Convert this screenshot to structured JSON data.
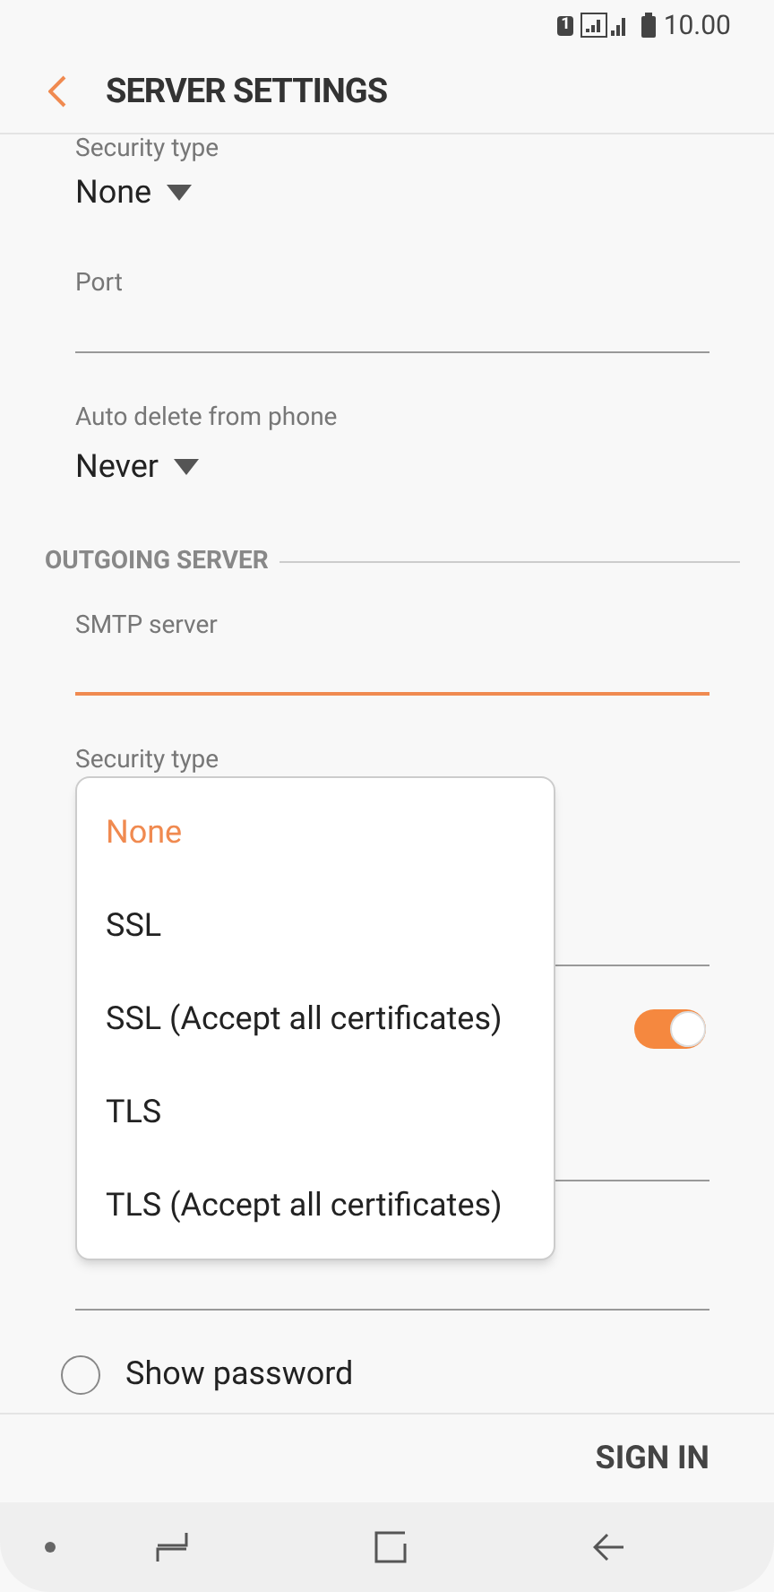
{
  "status_bar": {
    "sim": "1",
    "time": "10.00"
  },
  "header": {
    "title": "SERVER SETTINGS"
  },
  "incoming": {
    "security_label": "Security type",
    "security_value": "None",
    "port_label": "Port",
    "auto_delete_label": "Auto delete from phone",
    "auto_delete_value": "Never"
  },
  "outgoing": {
    "section_title": "OUTGOING SERVER",
    "smtp_label": "SMTP server",
    "security_label": "Security type",
    "toggle": {
      "on": true
    }
  },
  "dropdown": {
    "options": [
      {
        "label": "None",
        "selected": true
      },
      {
        "label": "SSL",
        "selected": false
      },
      {
        "label": "SSL (Accept all certificates)",
        "selected": false
      },
      {
        "label": "TLS",
        "selected": false
      },
      {
        "label": "TLS (Accept all certificates)",
        "selected": false
      }
    ]
  },
  "show_password": {
    "label": "Show password",
    "checked": false
  },
  "footer": {
    "button": "SIGN IN"
  }
}
